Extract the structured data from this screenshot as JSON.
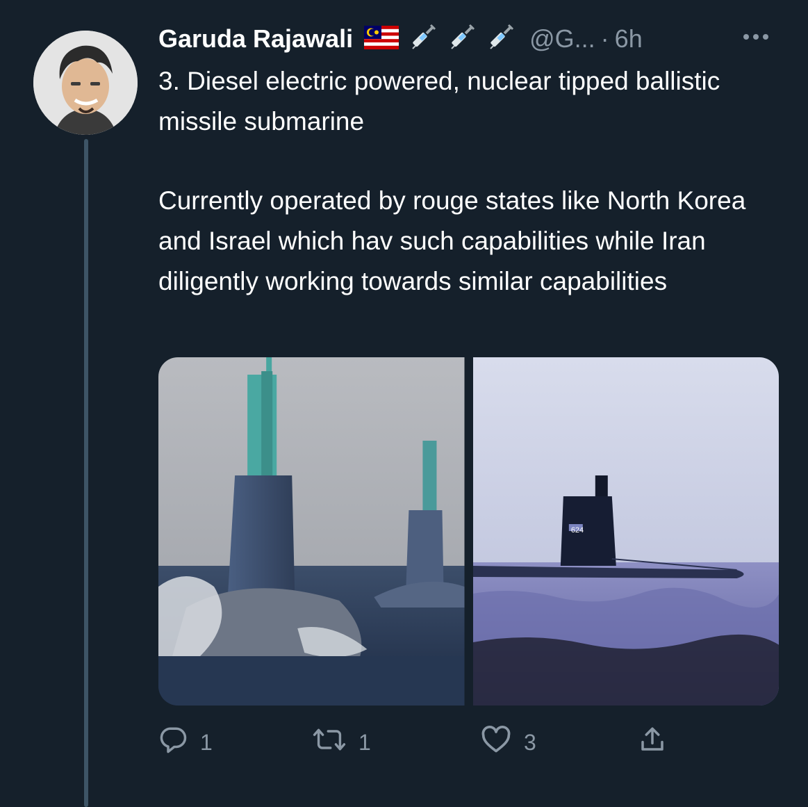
{
  "tweet": {
    "author_name": "Garuda Rajawali",
    "handle": "@G...",
    "separator": "·",
    "time": "6h",
    "text_paragraph_1": "3. Diesel electric powered, nuclear tipped ballistic missile submarine",
    "text_paragraph_2": "Currently operated by rouge states like North Korea and Israel which hav such capabilities while Iran diligently working towards similar capabilities"
  },
  "media": {
    "image_2_hull_number": "624"
  },
  "actions": {
    "replies": "1",
    "retweets": "1",
    "likes": "3"
  },
  "icons": [
    "flag-icon",
    "syringe-icon",
    "more-options-icon",
    "reply-icon",
    "retweet-icon",
    "like-icon",
    "share-icon"
  ],
  "colors": {
    "background": "#15202b",
    "text_primary": "#ffffff",
    "text_secondary": "#8b98a5",
    "thread_line": "#3d5466"
  }
}
